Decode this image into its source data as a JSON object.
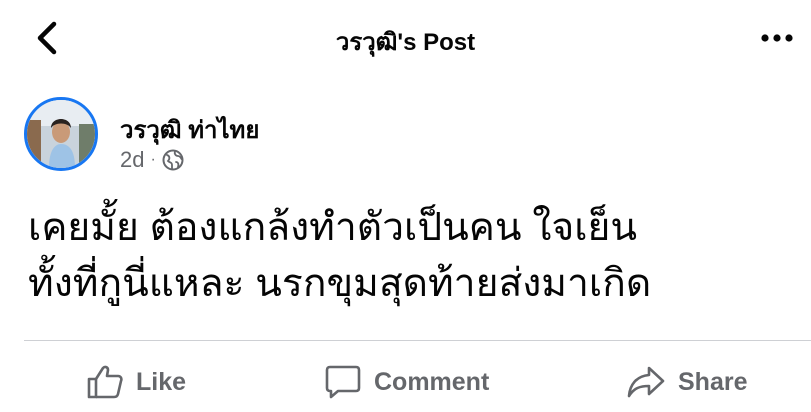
{
  "header": {
    "title": "วรวุฒิ's Post"
  },
  "post": {
    "author": "วรวุฒิ ท่าไทย",
    "time": "2d",
    "separator": "·",
    "lines": [
      "เคยมั้ย ต้องแกล้งทำตัวเป็นคน ใจเย็น",
      "ทั้งที่กูนี่แหละ นรกขุมสุดท้ายส่งมาเกิด"
    ]
  },
  "actions": {
    "like": "Like",
    "comment": "Comment",
    "share": "Share"
  },
  "colors": {
    "accent": "#1877f2",
    "secondary_text": "#65676b",
    "divider": "#ced0d4"
  }
}
